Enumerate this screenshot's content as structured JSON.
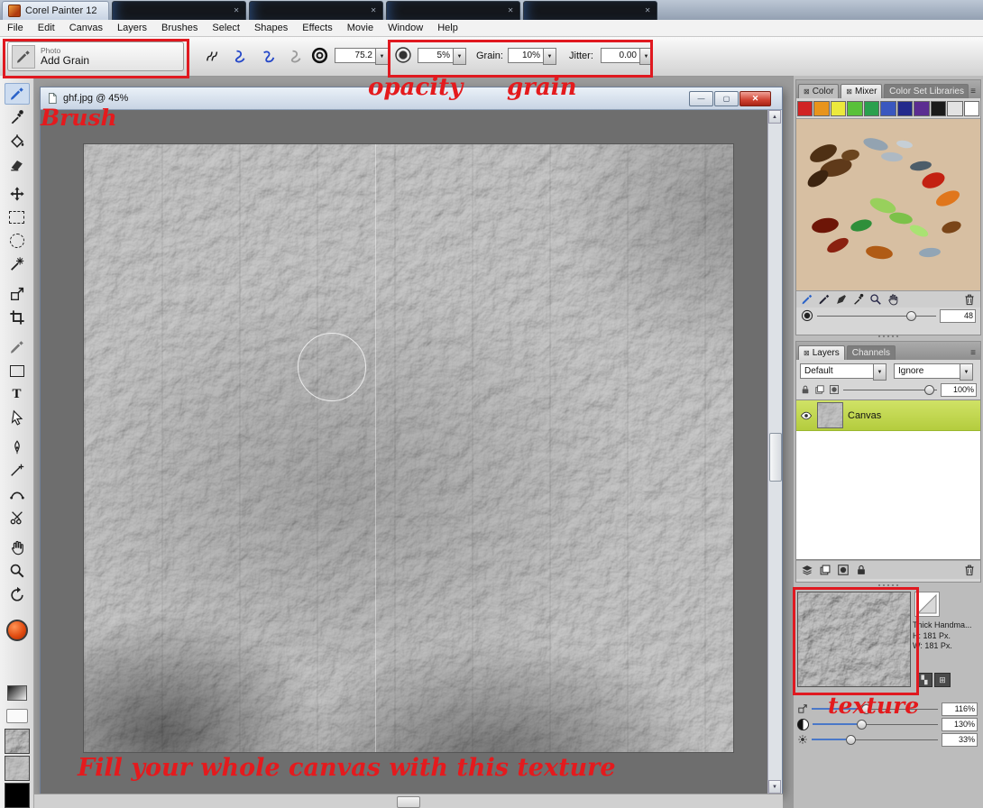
{
  "titlebar": {
    "app_tab": "Corel Painter 12"
  },
  "menubar": {
    "items": [
      "File",
      "Edit",
      "Canvas",
      "Layers",
      "Brushes",
      "Select",
      "Shapes",
      "Effects",
      "Movie",
      "Window",
      "Help"
    ]
  },
  "toolbar": {
    "brush_category": "Photo",
    "brush_variant": "Add Grain",
    "opacity_value": "75.2",
    "resat_value": "5%",
    "grain_label": "Grain:",
    "grain_value": "10%",
    "jitter_label": "Jitter:",
    "jitter_value": "0.00"
  },
  "annotations": {
    "brush": "Brush",
    "opacity": "opacity",
    "grain": "grain",
    "fill_note": "Fill your whole canvas with this texture",
    "texture": "texture",
    "color": "#e41a1d"
  },
  "document": {
    "title": "ghf.jpg @ 45%"
  },
  "color_panel": {
    "tabs": [
      "Color",
      "Mixer",
      "Color Set Libraries"
    ],
    "swatches": [
      "#d02424",
      "#e8941c",
      "#ece93c",
      "#59c13a",
      "#2aa04e",
      "#3a57bf",
      "#232a8c",
      "#5b2d91",
      "#1a1a1a",
      "#e2e2e2",
      "#ffffff"
    ],
    "daubs": [
      "#4e3014",
      "#5f3a1a",
      "#3c2410",
      "#6b451f",
      "#93a3b1",
      "#aeb9c3",
      "#c6cfd6",
      "#4d5d69",
      "#c32112",
      "#e0761c",
      "#98d05c",
      "#7cc14a",
      "#a9e273",
      "#2f8f3a",
      "#6d1507",
      "#8a2110",
      "#b05b15",
      "#92a5b5",
      "#7a4518"
    ],
    "mix_value": "48"
  },
  "layers_panel": {
    "tabs": [
      "Layers",
      "Channels"
    ],
    "composite_method": "Default",
    "composite_depth": "Ignore",
    "opacity_value": "100%",
    "layers": [
      {
        "name": "Canvas"
      }
    ]
  },
  "paper_panel": {
    "name": "Thick Handma...",
    "height_label": "H:",
    "height_value": "181 Px.",
    "width_label": "W:",
    "width_value": "181 Px.",
    "scale_value": "116%",
    "contrast_value": "130%",
    "brightness_value": "33%"
  },
  "icons": {
    "dropdown_arrow": "▼",
    "panel_menu": "≡",
    "tab_close": "✕",
    "tab_close_box": "⊠",
    "minimize": "—",
    "maximize": "▢",
    "close": "✕",
    "text_tool": "T",
    "paper_invert": "▚",
    "paper_grid": "⊞",
    "scroll_up": "▲",
    "scroll_down": "▼"
  },
  "tool_names": [
    "brush",
    "dropper",
    "paint-bucket",
    "eraser",
    "layer-adjuster",
    "rect-select",
    "oval-select",
    "magic-wand",
    "transform",
    "crop",
    "cloner",
    "rect-shape",
    "text",
    "shape-select",
    "pen",
    "add-point",
    "quick-curve",
    "scissors",
    "grabber",
    "magnifier",
    "rotate-page",
    "main-color",
    "gradient-selector",
    "nozzle-selector",
    "paper-selector",
    "pattern-selector",
    "weave-selector"
  ]
}
